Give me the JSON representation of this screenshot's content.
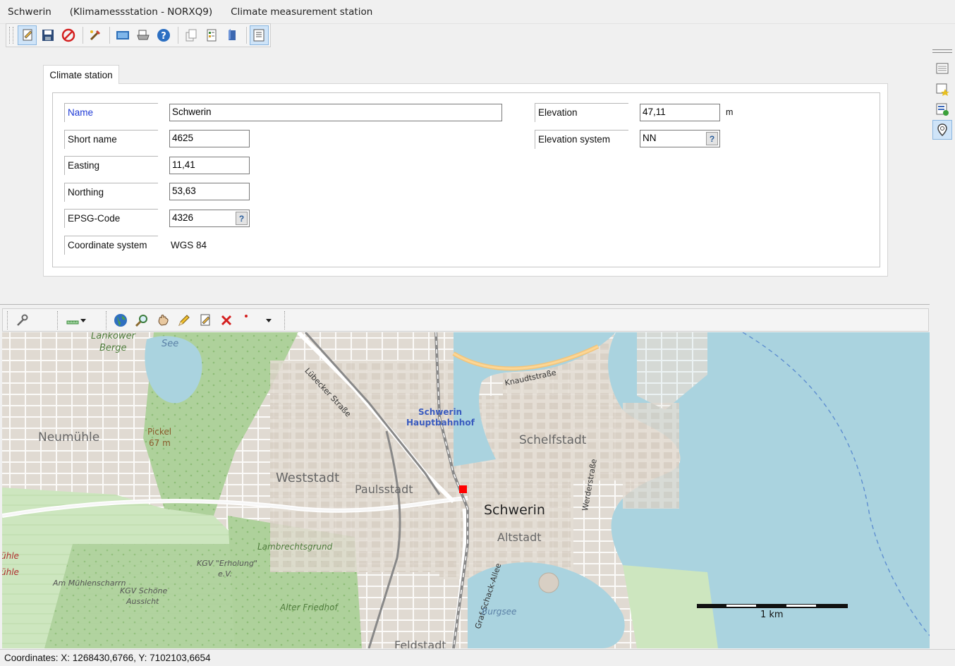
{
  "window": {
    "station_name": "Schwerin",
    "station_id": "(Klimamessstation - NORXQ9)",
    "station_type": "Climate measurement station"
  },
  "toolbar": {
    "buttons": [
      "edit-icon",
      "save-icon",
      "cancel-icon",
      "tools-icon",
      "screen-icon",
      "print-icon",
      "help-icon",
      "copy-icon",
      "report-icon",
      "book-icon",
      "form-view-icon"
    ]
  },
  "right_panel": {
    "buttons": [
      "list-view-icon",
      "star-doc-icon",
      "checked-doc-icon",
      "location-pin-icon"
    ]
  },
  "tab": {
    "label": "Climate station"
  },
  "form": {
    "name_label": "Name",
    "name_value": "Schwerin",
    "short_name_label": "Short name",
    "short_name_value": "4625",
    "easting_label": "Easting",
    "easting_value": "11,41",
    "northing_label": "Northing",
    "northing_value": "53,63",
    "epsg_label": "EPSG-Code",
    "epsg_value": "4326",
    "coord_system_label": "Coordinate system",
    "coord_system_value": "WGS 84",
    "elevation_label": "Elevation",
    "elevation_value": "47,11",
    "elevation_unit": "m",
    "elevation_system_label": "Elevation system",
    "elevation_system_value": "NN",
    "lookup_symbol": "?"
  },
  "map": {
    "labels": {
      "lankower": "Lankower",
      "berge": "Berge",
      "see": "See",
      "luebecker": "Lübecker Straße",
      "knaudt": "Knaudtstraße",
      "hbf1": "Schwerin",
      "hbf2": "Hauptbahnhof",
      "schelfstadt": "Schelfstadt",
      "neumuehle": "Neumühle",
      "pickel1": "Pickel",
      "pickel2": "67 m",
      "weststadt": "Weststadt",
      "paulsstadt": "Paulsstadt",
      "schwerin": "Schwerin",
      "altstadt": "Altstadt",
      "werder": "Werderstraße",
      "lambrecht": "Lambrechtsgrund",
      "kgv1": "KGV \"Erholung\"",
      "kgv2": "e.V.",
      "muehlenscharrn": "Am Mühlenscharrn",
      "schoene1": "KGV Schöne",
      "schoene2": "Aussicht",
      "friedhof": "Alter Friedhof",
      "schack": "Graf-Schack-Allee",
      "burgsee": "Burgsee",
      "feldstadt": "Feldstadt",
      "uhle1": "ühle",
      "uhle2": "ühle",
      "scale": "1 km"
    }
  },
  "status": {
    "coordinates": "Coordinates: X: 1268430,6766, Y: 7102103,6654"
  }
}
